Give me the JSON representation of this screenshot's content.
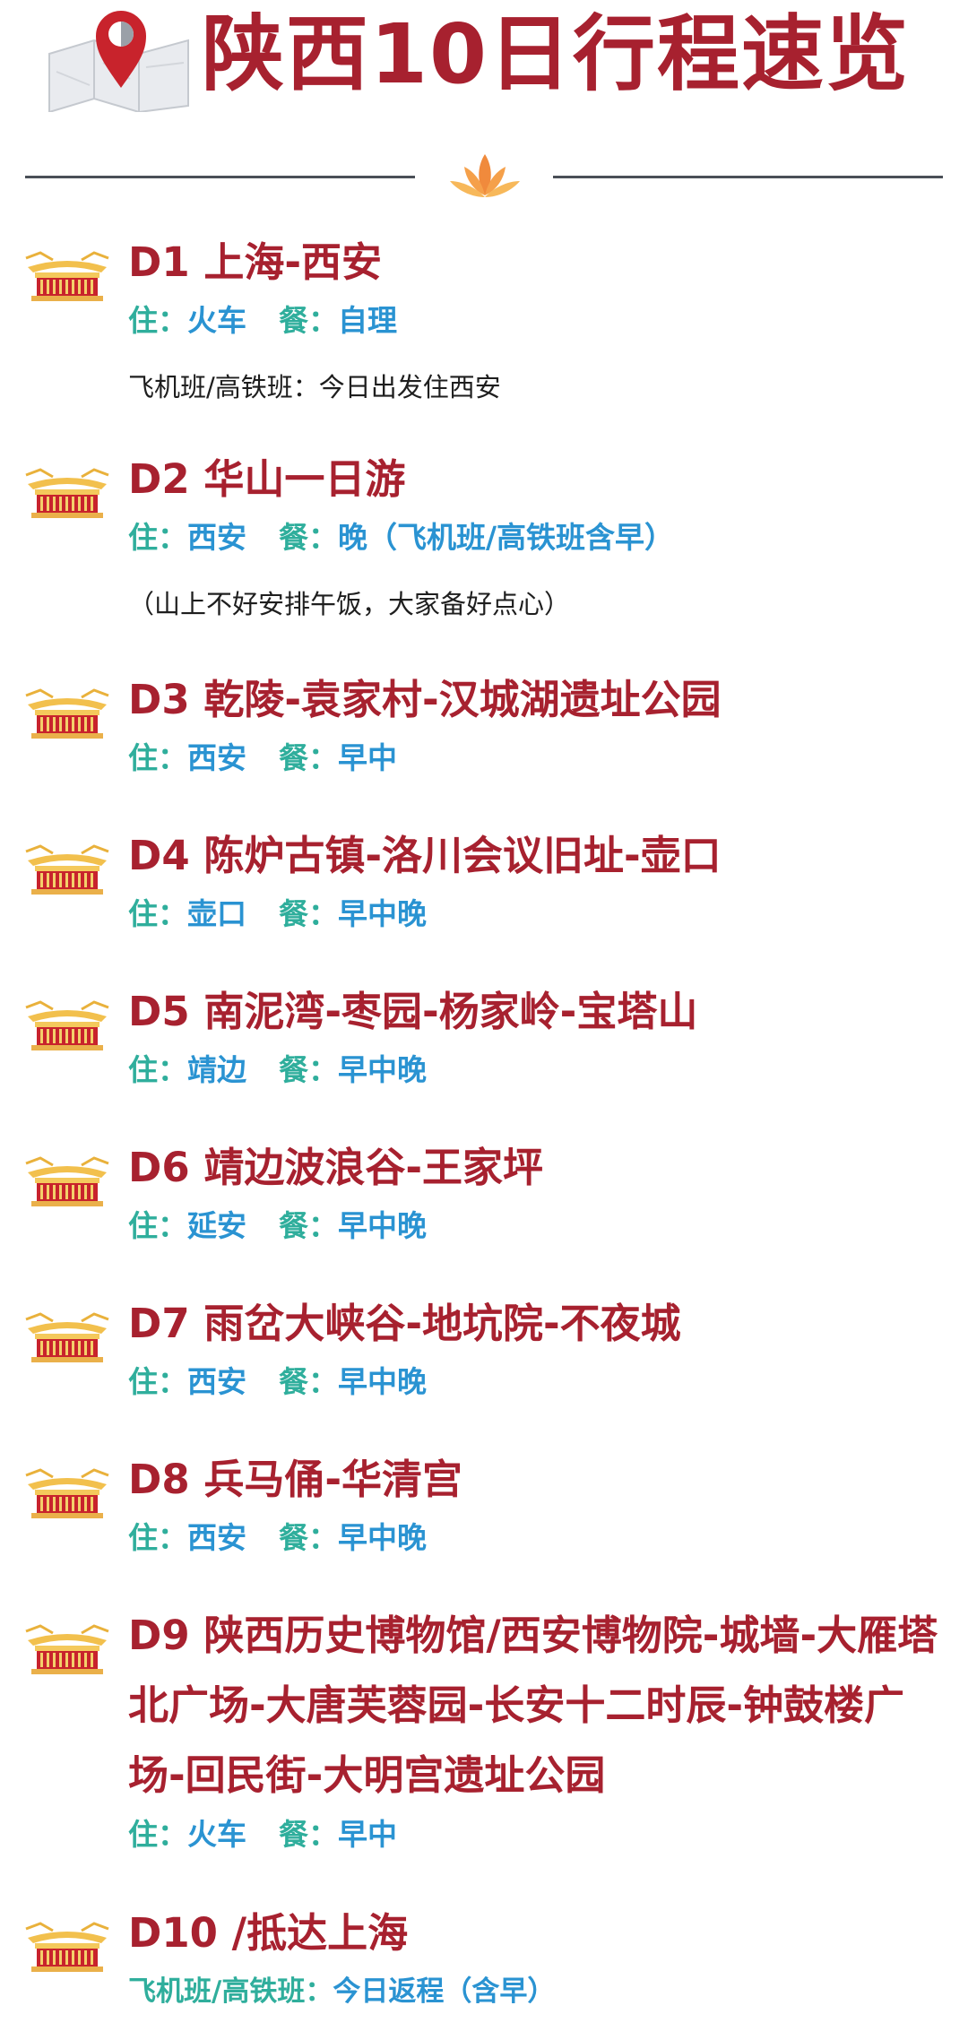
{
  "header": {
    "title": "陕西10日行程速览"
  },
  "colors": {
    "title_red": "#a7212f",
    "label_teal": "#2fae9c",
    "value_blue": "#2a93d2",
    "divider_gray": "#4a4f57"
  },
  "days": [
    {
      "title": "D1  上海-西安",
      "stay_label": "住：",
      "stay_value": "火车",
      "meal_label": "餐：",
      "meal_value": "自理",
      "note": "飞机班/高铁班：今日出发住西安"
    },
    {
      "title": "D2  华山一日游",
      "stay_label": "住：",
      "stay_value": "西安",
      "meal_label": "餐：",
      "meal_value": "晚（飞机班/高铁班含早）",
      "note": "（山上不好安排午饭，大家备好点心）"
    },
    {
      "title": "D3 乾陵-袁家村-汉城湖遗址公园",
      "stay_label": "住：",
      "stay_value": "西安",
      "meal_label": "餐：",
      "meal_value": "早中"
    },
    {
      "title": "D4 陈炉古镇-洛川会议旧址-壶口",
      "stay_label": "住：",
      "stay_value": "壶口",
      "meal_label": "餐：",
      "meal_value": "早中晚"
    },
    {
      "title": "D5  南泥湾-枣园-杨家岭-宝塔山",
      "stay_label": "住：",
      "stay_value": "靖边",
      "meal_label": "餐：",
      "meal_value": "早中晚"
    },
    {
      "title": "D6  靖边波浪谷-王家坪",
      "stay_label": "住：",
      "stay_value": "延安",
      "meal_label": "餐：",
      "meal_value": "早中晚"
    },
    {
      "title": "D7  雨岔大峡谷-地坑院-不夜城",
      "stay_label": "住：",
      "stay_value": "西安",
      "meal_label": "餐：",
      "meal_value": "早中晚"
    },
    {
      "title": "D8  兵马俑-华清宫",
      "stay_label": "住：",
      "stay_value": "西安",
      "meal_label": "餐：",
      "meal_value": "早中晚"
    },
    {
      "title": "D9 陕西历史博物馆/西安博物院-城墙-大雁塔北广场-大唐芙蓉园-长安十二时辰-钟鼓楼广场-回民街-大明宫遗址公园",
      "stay_label": "住：",
      "stay_value": "火车",
      "meal_label": "餐：",
      "meal_value": "早中"
    },
    {
      "title": "D10 /抵达上海",
      "note_label": "飞机班/高铁班：",
      "note_value": "今日返程（含早）"
    }
  ]
}
